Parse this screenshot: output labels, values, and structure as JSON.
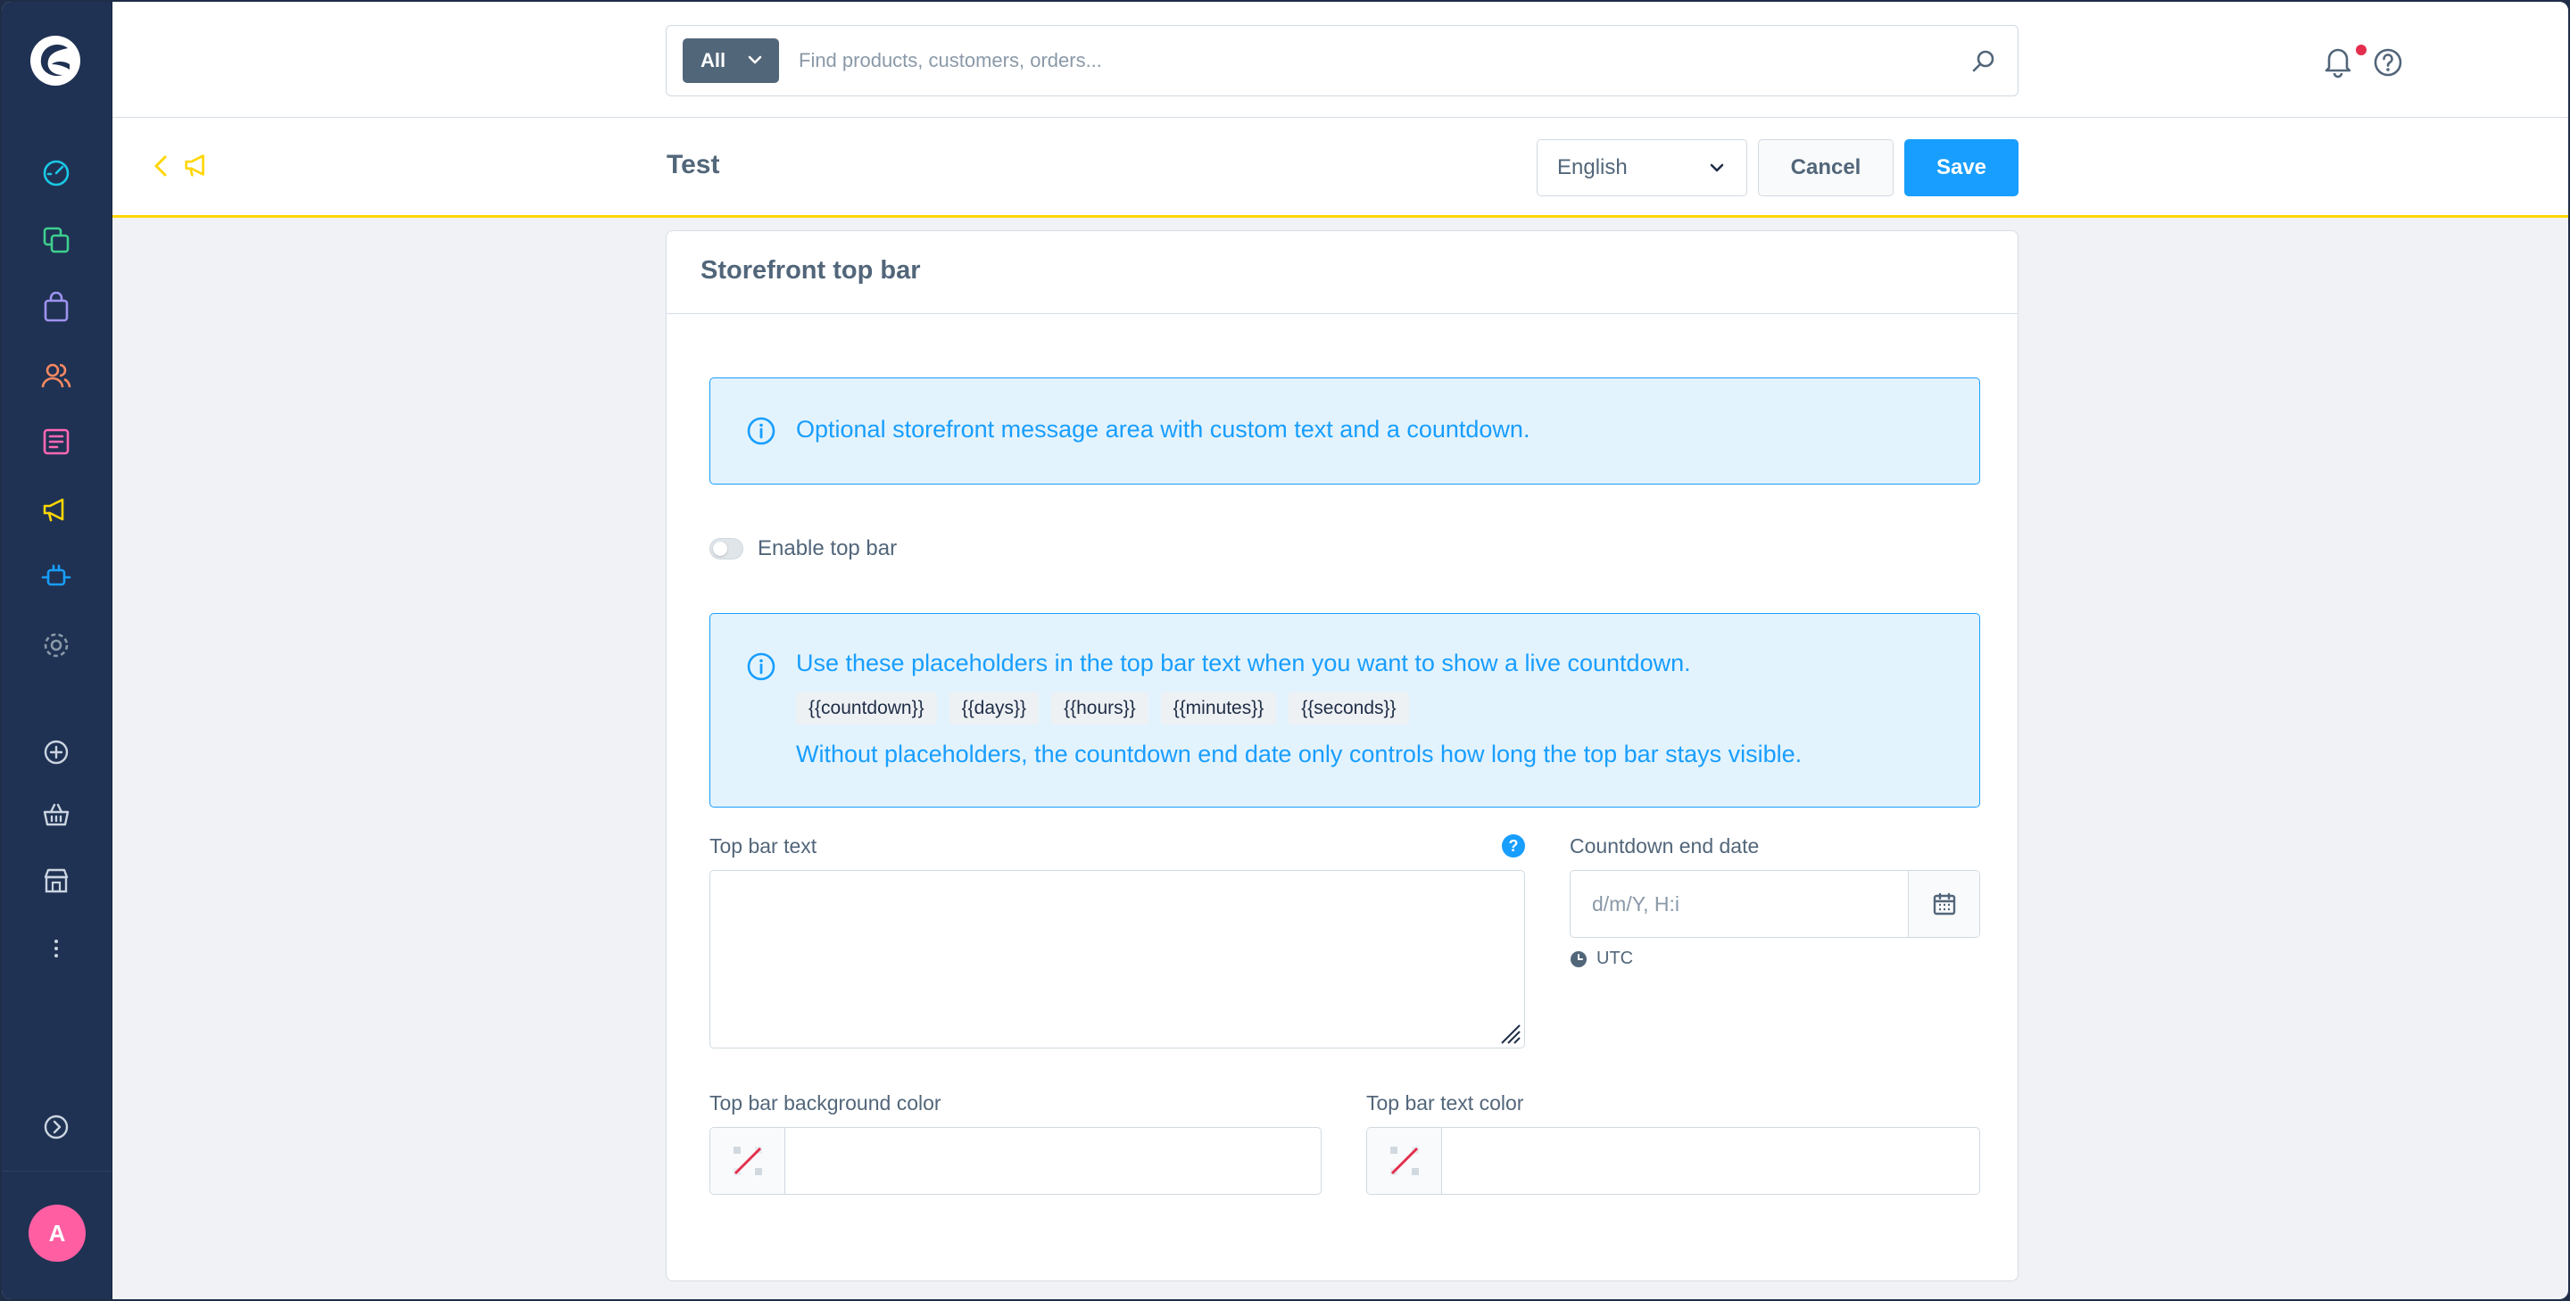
{
  "search": {
    "type_label": "All",
    "placeholder": "Find products, customers, orders..."
  },
  "header": {
    "title": "Test",
    "language": "English",
    "cancel_label": "Cancel",
    "save_label": "Save"
  },
  "card": {
    "title": "Storefront top bar",
    "info_text": "Optional storefront message area with custom text and a countdown.",
    "toggle_label": "Enable top bar",
    "placeholder_info": {
      "line1": "Use these placeholders in the top bar text when you want to show a live countdown.",
      "chips": [
        "{{countdown}}",
        "{{days}}",
        "{{hours}}",
        "{{minutes}}",
        "{{seconds}}"
      ],
      "line3": "Without placeholders, the countdown end date only controls how long the top bar stays visible."
    },
    "top_bar_text_label": "Top bar text",
    "countdown_label": "Countdown end date",
    "date_placeholder": "d/m/Y, H:i",
    "timezone": "UTC",
    "bg_color_label": "Top bar background color",
    "text_color_label": "Top bar text color"
  },
  "avatar": {
    "initial": "A"
  },
  "colors": {
    "sidebar": "#1f3253",
    "accent": "#189eff",
    "header_border": "#ffd600",
    "avatar": "#ff5fa2"
  }
}
